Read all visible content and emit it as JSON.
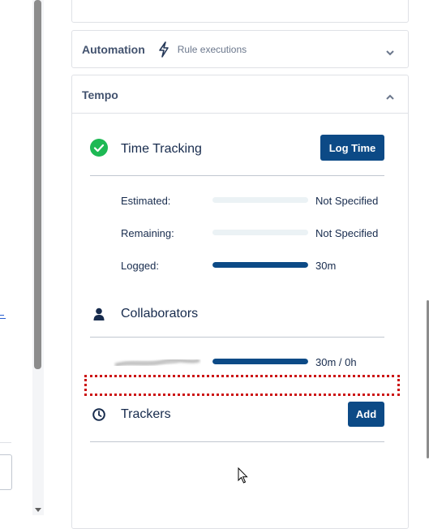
{
  "automation": {
    "title": "Automation",
    "subtitle": "Rule executions",
    "icons": {
      "bolt": "lightning-bolt-icon",
      "toggle": "chevron-down-icon"
    }
  },
  "tempo": {
    "title": "Tempo",
    "toggle_icon": "chevron-up-icon",
    "time_tracking": {
      "title": "Time Tracking",
      "icon": "check-circle-icon",
      "log_button": "Log Time",
      "rows": [
        {
          "label": "Estimated:",
          "value": "Not Specified",
          "progress": 0
        },
        {
          "label": "Remaining:",
          "value": "Not Specified",
          "progress": 0
        },
        {
          "label": "Logged:",
          "value": "30m",
          "progress": 1
        }
      ]
    },
    "collaborators": {
      "title": "Collaborators",
      "icon": "person-icon",
      "rows": [
        {
          "name_blurred": true,
          "value": "30m / 0h",
          "progress": 1
        }
      ]
    },
    "trackers": {
      "title": "Trackers",
      "icon": "clock-icon",
      "add_button": "Add"
    }
  },
  "colors": {
    "primary": "#0c4a86",
    "success": "#1db954",
    "highlight_border": "#cc1414",
    "bar_track": "#ebf2f5"
  }
}
